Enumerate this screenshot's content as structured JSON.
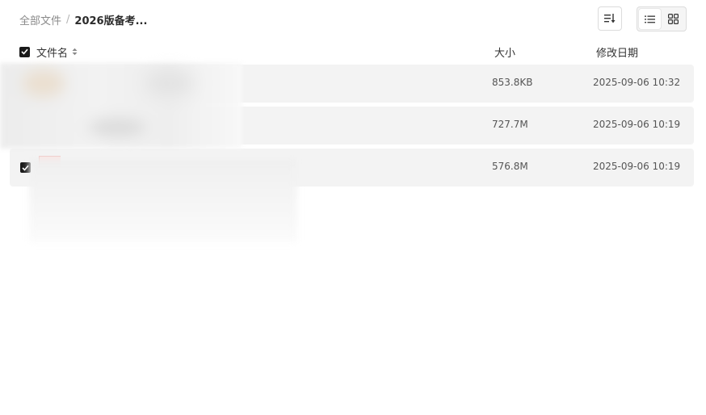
{
  "breadcrumb": {
    "root": "全部文件",
    "separator": "/",
    "current": "2026版备考..."
  },
  "toolbar": {
    "sort_icon": "sort-descending-icon",
    "list_view_icon": "list-view-icon",
    "grid_view_icon": "grid-view-icon",
    "active_view": "list"
  },
  "columns": {
    "name": "文件名",
    "size": "大小",
    "modified": "修改日期"
  },
  "select_all_checked": true,
  "files": [
    {
      "name": "",
      "size": "853.8KB",
      "modified": "2025-09-06 10:32",
      "checked": false
    },
    {
      "name": "",
      "size": "727.7M",
      "modified": "2025-09-06 10:19",
      "checked": false
    },
    {
      "name": "",
      "size": "576.8M",
      "modified": "2025-09-06 10:19",
      "checked": true
    }
  ],
  "colors": {
    "row_bg": "#f3f3f3",
    "checkbox": "#1a1a1a",
    "muted_text": "#8a8a8a"
  }
}
